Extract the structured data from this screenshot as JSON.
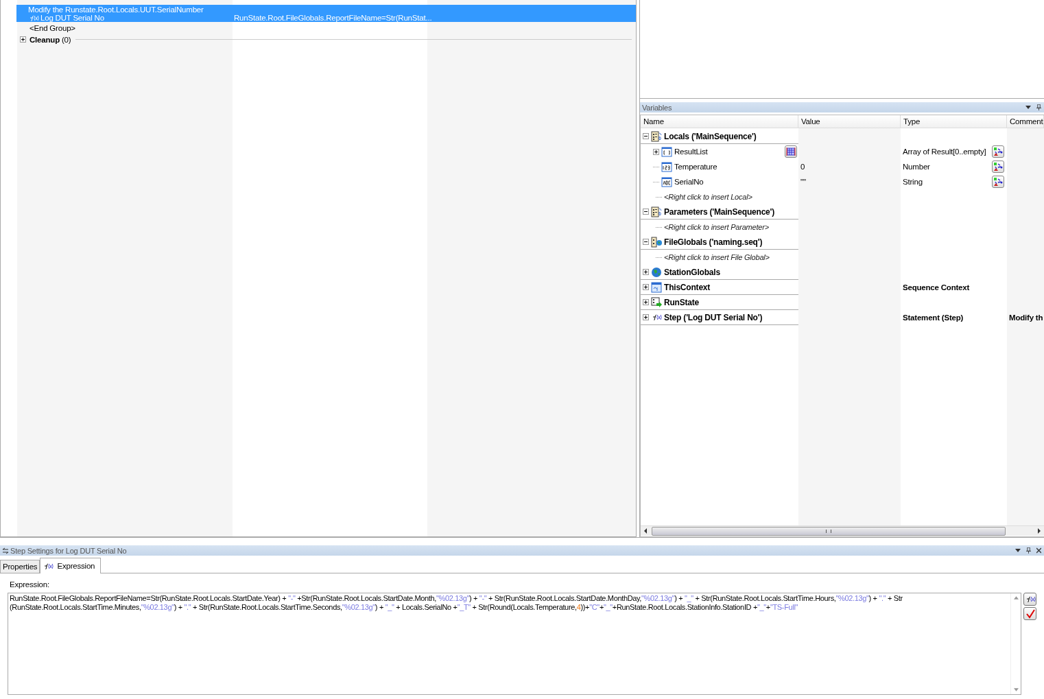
{
  "sequence_pane": {
    "rows": [
      {
        "kind": "step",
        "selected": true,
        "description": "Modify the Runstate.Root.Locals.UUT.SerialNumber",
        "name": "Log DUT Serial No",
        "value": "RunState.Root.FileGlobals.ReportFileName=Str(RunStat..."
      },
      {
        "kind": "end",
        "selected": false,
        "name": "<End Group>"
      },
      {
        "kind": "group",
        "selected": false,
        "expanded": false,
        "name": "Cleanup",
        "count": "(0)"
      }
    ]
  },
  "variables": {
    "title": "Variables",
    "columns": [
      "Name",
      "Value",
      "Type",
      "Comment"
    ],
    "items": [
      {
        "kind": "locals",
        "name": "Locals ('MainSequence')",
        "expanded": true,
        "children": [
          {
            "kind": "array",
            "name": "ResultList",
            "expanded": false,
            "value_button": true,
            "type": "Array of Result[0..empty]",
            "type_button": true
          },
          {
            "kind": "number",
            "name": "Temperature",
            "value": "0",
            "type": "Number",
            "type_button": true
          },
          {
            "kind": "string",
            "name": "SerialNo",
            "value": "\"\"",
            "type": "String",
            "type_button": true
          },
          {
            "kind": "placeholder",
            "name": "<Right click to insert Local>"
          }
        ]
      },
      {
        "kind": "parameters",
        "name": "Parameters ('MainSequence')",
        "expanded": true,
        "children": [
          {
            "kind": "placeholder",
            "name": "<Right click to insert Parameter>"
          }
        ]
      },
      {
        "kind": "file_globals",
        "name": "FileGlobals ('naming.seq')",
        "expanded": true,
        "children": [
          {
            "kind": "placeholder",
            "name": "<Right click to insert File Global>"
          }
        ]
      },
      {
        "kind": "station_globals",
        "name": "StationGlobals",
        "expanded": false
      },
      {
        "kind": "context",
        "name": "ThisContext",
        "expanded": false,
        "type": "Sequence Context"
      },
      {
        "kind": "runstate",
        "name": "RunState",
        "expanded": false
      },
      {
        "kind": "step",
        "name": "Step ('Log DUT Serial No')",
        "expanded": false,
        "type": "Statement (Step)",
        "comment": "Modify th"
      }
    ]
  },
  "step_settings": {
    "title": "Step Settings for Log DUT Serial No",
    "tabs": [
      {
        "label": "Properties",
        "selected": false,
        "icon": false
      },
      {
        "label": "Expression",
        "selected": true,
        "icon": true
      }
    ],
    "expression_label": "Expression:",
    "expression_lines": [
      [
        {
          "kind": "code",
          "text": "RunState.Root.FileGlobals.ReportFileName=Str(RunState.Root.Locals.StartDate.Year) + "
        },
        {
          "kind": "string",
          "text": "\"-\""
        },
        {
          "kind": "code",
          "text": " +Str(RunState.Root.Locals.StartDate.Month,"
        },
        {
          "kind": "string",
          "text": "\"%02.13g\""
        },
        {
          "kind": "code",
          "text": ") + "
        },
        {
          "kind": "string",
          "text": "\"-\""
        },
        {
          "kind": "code",
          "text": " + Str(RunState.Root.Locals.StartDate.MonthDay,"
        },
        {
          "kind": "string",
          "text": "\"%02.13g\""
        },
        {
          "kind": "code",
          "text": ") + "
        },
        {
          "kind": "string",
          "text": "\"_\""
        },
        {
          "kind": "code",
          "text": " + Str(RunState.Root.Locals.StartTime.Hours,"
        },
        {
          "kind": "string",
          "text": "\"%02.13g\""
        },
        {
          "kind": "code",
          "text": ") + "
        },
        {
          "kind": "string",
          "text": "\".\""
        },
        {
          "kind": "code",
          "text": " + Str"
        }
      ],
      [
        {
          "kind": "code",
          "text": "(RunState.Root.Locals.StartTime.Minutes,"
        },
        {
          "kind": "string",
          "text": "\"%02.13g\""
        },
        {
          "kind": "code",
          "text": ") + "
        },
        {
          "kind": "string",
          "text": "\".\""
        },
        {
          "kind": "code",
          "text": " + Str(RunState.Root.Locals.StartTime.Seconds,"
        },
        {
          "kind": "string",
          "text": "\"%02.13g\""
        },
        {
          "kind": "code",
          "text": ") + "
        },
        {
          "kind": "string",
          "text": "\"_\""
        },
        {
          "kind": "code",
          "text": " + Locals.SerialNo +"
        },
        {
          "kind": "string",
          "text": "\"_T\""
        },
        {
          "kind": "code",
          "text": " + Str(Round(Locals.Temperature,"
        },
        {
          "kind": "number",
          "text": "4"
        },
        {
          "kind": "code",
          "text": "))+"
        },
        {
          "kind": "string",
          "text": "\"C\""
        },
        {
          "kind": "code",
          "text": "+"
        },
        {
          "kind": "string",
          "text": "\"_\""
        },
        {
          "kind": "code",
          "text": "+RunState.Root.Locals.StationInfo.StationID +"
        },
        {
          "kind": "string",
          "text": "\"_\""
        },
        {
          "kind": "code",
          "text": "+"
        },
        {
          "kind": "string",
          "text": "\"TS-Full\""
        }
      ]
    ]
  }
}
